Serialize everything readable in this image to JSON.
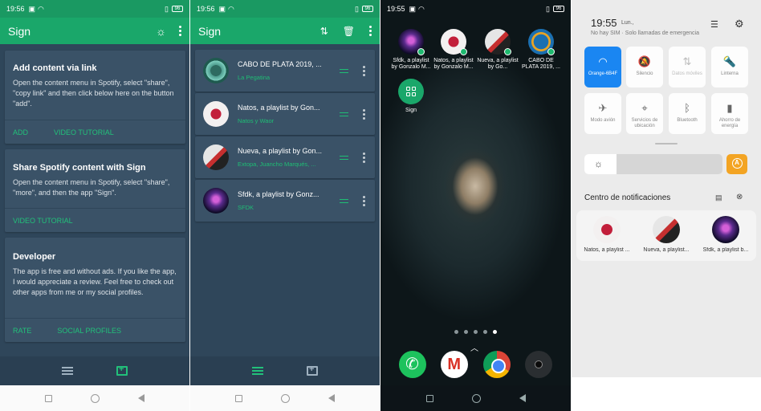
{
  "panel1": {
    "status": {
      "time": "19:56",
      "battery": "96"
    },
    "app_title": "Sign",
    "card1": {
      "title": "Add content via link",
      "body": "Open the content menu in Spotify, select \"share\", \"copy link\" and then click below here on the button \"add\".",
      "btn1": "ADD",
      "btn2": "VIDEO TUTORIAL"
    },
    "card2": {
      "title": "Share Spotify content with Sign",
      "body": "Open the content menu in Spotify, select \"share\", \"more\", and then the app \"Sign\".",
      "btn1": "VIDEO TUTORIAL"
    },
    "card3": {
      "title": "Developer",
      "body": "The app is free and without ads. If you like the app, I would appreciate a review. Feel free to check out other apps from me or my social profiles.",
      "btn1": "RATE",
      "btn2": "SOCIAL PROFILES"
    }
  },
  "panel2": {
    "status": {
      "time": "19:56",
      "battery": "96"
    },
    "app_title": "Sign",
    "items": [
      {
        "title": "CABO DE PLATA 2019, ...",
        "subtitle": "La Pegatina"
      },
      {
        "title": "Natos, a playlist by Gon...",
        "subtitle": "Natos y Waor"
      },
      {
        "title": "Nueva, a playlist by Gon...",
        "subtitle": "Extopa, Juancho Marqués, ..."
      },
      {
        "title": "Sfdk, a playlist by Gonz...",
        "subtitle": "SFDK"
      }
    ]
  },
  "panel3": {
    "status": {
      "time": "19:55",
      "battery": "96"
    },
    "apps": [
      {
        "label": "Sfdk, a playlist by Gonzalo M..."
      },
      {
        "label": "Natos, a playlist by Gonzalo M..."
      },
      {
        "label": "Nueva, a playlist by Go..."
      },
      {
        "label": "CABO DE PLATA 2019, ..."
      },
      {
        "label": "Sign"
      }
    ]
  },
  "panel4": {
    "time": "19:55",
    "date": "Lun.,",
    "sim": "No hay SIM · Solo llamadas de emergencia",
    "tiles": [
      {
        "label": "Orange-6B4F"
      },
      {
        "label": "Silencio"
      },
      {
        "label": "Datos móviles"
      },
      {
        "label": "Linterna"
      },
      {
        "label": "Modo avión"
      },
      {
        "label": "Servicios de ubicación"
      },
      {
        "label": "Bluetooth"
      },
      {
        "label": "Ahorro de energía"
      }
    ],
    "notifications_title": "Centro de notificaciones",
    "notifications": [
      {
        "label": "Natos, a playlist ..."
      },
      {
        "label": "Nueva, a playlist..."
      },
      {
        "label": "Sfdk, a playlist b..."
      }
    ]
  },
  "colors": {
    "accent": "#1aa76a",
    "app_bg": "#2f465a",
    "card": "#3a5267",
    "qs_active": "#1a86f2"
  }
}
